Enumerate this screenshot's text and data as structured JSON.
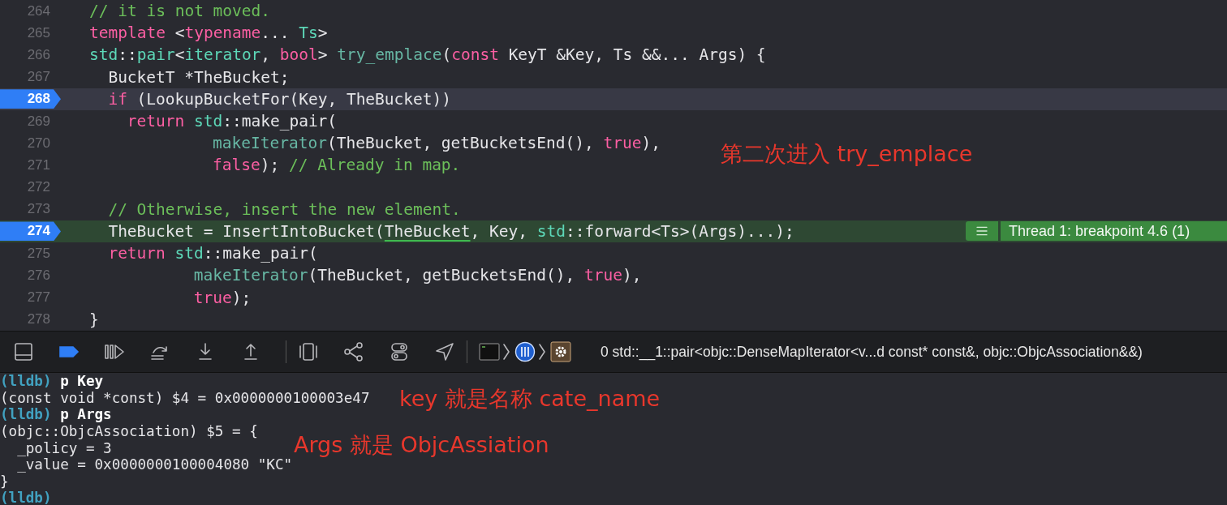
{
  "editor": {
    "lines": [
      {
        "number": "264",
        "breakpoint": false,
        "cursor": false,
        "executing": false,
        "tokens": [
          {
            "kind": "comment",
            "text": "// it is not moved."
          }
        ]
      },
      {
        "number": "265",
        "breakpoint": false,
        "cursor": false,
        "executing": false,
        "tokens": [
          {
            "kind": "keyword",
            "text": "template"
          },
          {
            "kind": "plain",
            "text": " <"
          },
          {
            "kind": "keyword",
            "text": "typename"
          },
          {
            "kind": "plain",
            "text": "... "
          },
          {
            "kind": "type",
            "text": "Ts"
          },
          {
            "kind": "plain",
            "text": ">"
          }
        ]
      },
      {
        "number": "266",
        "breakpoint": false,
        "cursor": false,
        "executing": false,
        "tokens": [
          {
            "kind": "type",
            "text": "std"
          },
          {
            "kind": "plain",
            "text": "::"
          },
          {
            "kind": "type",
            "text": "pair"
          },
          {
            "kind": "plain",
            "text": "<"
          },
          {
            "kind": "type",
            "text": "iterator"
          },
          {
            "kind": "plain",
            "text": ", "
          },
          {
            "kind": "keyword",
            "text": "bool"
          },
          {
            "kind": "plain",
            "text": "> "
          },
          {
            "kind": "function",
            "text": "try_emplace"
          },
          {
            "kind": "plain",
            "text": "("
          },
          {
            "kind": "keyword",
            "text": "const"
          },
          {
            "kind": "plain",
            "text": " KeyT &Key, Ts &&... Args) {"
          }
        ]
      },
      {
        "number": "267",
        "breakpoint": false,
        "cursor": false,
        "executing": false,
        "tokens": [
          {
            "kind": "plain",
            "text": "BucketT *TheBucket;"
          }
        ]
      },
      {
        "number": "268",
        "breakpoint": true,
        "cursor": true,
        "executing": false,
        "tokens": [
          {
            "kind": "keyword",
            "text": "if"
          },
          {
            "kind": "plain",
            "text": " (LookupBucketFor(Key, TheBucket))"
          }
        ]
      },
      {
        "number": "269",
        "breakpoint": false,
        "cursor": false,
        "executing": false,
        "tokens": [
          {
            "kind": "keyword",
            "text": "return"
          },
          {
            "kind": "type",
            "text": " std"
          },
          {
            "kind": "plain",
            "text": "::make_pair("
          }
        ]
      },
      {
        "number": "270",
        "breakpoint": false,
        "cursor": false,
        "executing": false,
        "tokens": [
          {
            "kind": "function",
            "text": "makeIterator"
          },
          {
            "kind": "plain",
            "text": "(TheBucket, getBucketsEnd(), "
          },
          {
            "kind": "keyword",
            "text": "true"
          },
          {
            "kind": "plain",
            "text": "),"
          }
        ]
      },
      {
        "number": "271",
        "breakpoint": false,
        "cursor": false,
        "executing": false,
        "tokens": [
          {
            "kind": "keyword",
            "text": "false"
          },
          {
            "kind": "plain",
            "text": "); "
          },
          {
            "kind": "comment",
            "text": "// Already in map."
          }
        ]
      },
      {
        "number": "272",
        "breakpoint": false,
        "cursor": false,
        "executing": false
      },
      {
        "number": "273",
        "breakpoint": false,
        "cursor": false,
        "executing": false,
        "tokens": [
          {
            "kind": "comment",
            "text": "// Otherwise, insert the new element."
          }
        ]
      },
      {
        "number": "274",
        "breakpoint": true,
        "cursor": false,
        "executing": true,
        "tokens": [
          {
            "kind": "plain",
            "text": "TheBucket = InsertIntoBucket("
          },
          {
            "kind": "underlined",
            "text": "TheBucket"
          },
          {
            "kind": "plain",
            "text": ", Key, "
          },
          {
            "kind": "type",
            "text": "std"
          },
          {
            "kind": "plain",
            "text": "::forward<Ts>(Args)...);"
          }
        ]
      },
      {
        "number": "275",
        "breakpoint": false,
        "cursor": false,
        "executing": false,
        "tokens": [
          {
            "kind": "keyword",
            "text": "return"
          },
          {
            "kind": "type",
            "text": " std"
          },
          {
            "kind": "plain",
            "text": "::make_pair("
          }
        ]
      },
      {
        "number": "276",
        "breakpoint": false,
        "cursor": false,
        "executing": false,
        "tokens": [
          {
            "kind": "function",
            "text": "makeIterator"
          },
          {
            "kind": "plain",
            "text": "(TheBucket, getBucketsEnd(), "
          },
          {
            "kind": "keyword",
            "text": "true"
          },
          {
            "kind": "plain",
            "text": "),"
          }
        ]
      },
      {
        "number": "277",
        "breakpoint": false,
        "cursor": false,
        "executing": false,
        "tokens": [
          {
            "kind": "keyword",
            "text": "true"
          },
          {
            "kind": "plain",
            "text": ");"
          }
        ]
      },
      {
        "number": "278",
        "breakpoint": false,
        "cursor": false,
        "executing": false,
        "tokens": [
          {
            "kind": "plain",
            "text": "}"
          }
        ]
      }
    ],
    "thread_badge": {
      "label": "Thread 1: breakpoint 4.6 (1)"
    }
  },
  "debug_bar": {
    "breakpoints_active": true,
    "frame": "0 std::__1::pair<objc::DenseMapIterator<v...d const* const&, objc::ObjcAssociation&&)"
  },
  "console": {
    "lines": [
      {
        "kind": "prompt",
        "prompt": "(lldb)",
        "command": "p Key"
      },
      {
        "kind": "output",
        "text": "(const void *const) $4 = 0x0000000100003e47"
      },
      {
        "kind": "prompt",
        "prompt": "(lldb)",
        "command": "p Args"
      },
      {
        "kind": "output",
        "text": "(objc::ObjcAssociation) $5 = {"
      },
      {
        "kind": "output",
        "text": "  _policy = 3"
      },
      {
        "kind": "output",
        "text": "  _value = 0x0000000100004080 \"KC\""
      },
      {
        "kind": "output",
        "text": "}"
      },
      {
        "kind": "prompt",
        "prompt": "(lldb)"
      }
    ]
  },
  "annotations": [
    {
      "text": "第二次进入 try_emplace"
    },
    {
      "text": "key 就是名称 cate_name"
    },
    {
      "text": "Args 就是 ObjcAssiation"
    }
  ]
}
